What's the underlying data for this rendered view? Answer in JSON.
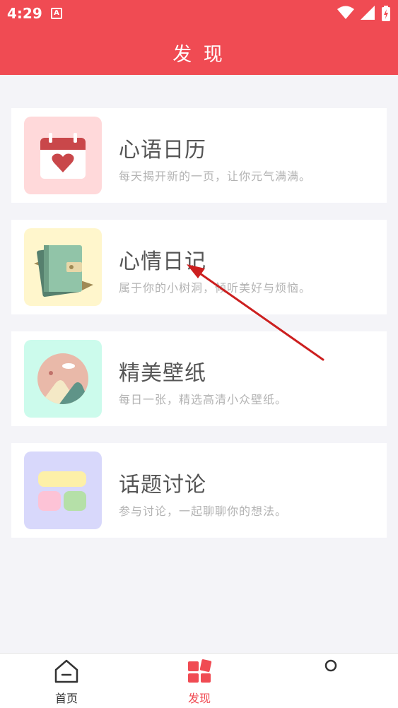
{
  "status_bar": {
    "time": "4:29",
    "app_icon": "A"
  },
  "header": {
    "title": "发 现"
  },
  "cards": [
    {
      "title": "心语日历",
      "desc": "每天揭开新的一页，让你元气满满。",
      "icon": "calendar-heart-icon",
      "bg": "#ffd9da"
    },
    {
      "title": "心情日记",
      "desc": "属于你的小树洞，倾听美好与烦恼。",
      "icon": "diary-notebook-icon",
      "bg": "#fff6cc"
    },
    {
      "title": "精美壁纸",
      "desc": "每日一张，精选高清小众壁纸。",
      "icon": "landscape-picture-icon",
      "bg": "#ccfbec"
    },
    {
      "title": "话题讨论",
      "desc": "参与讨论，一起聊聊你的想法。",
      "icon": "topic-blocks-icon",
      "bg": "#d8d8fb"
    }
  ],
  "tabbar": [
    {
      "label": "首页",
      "icon": "home-icon"
    },
    {
      "label": "发现",
      "icon": "discover-icon",
      "active": true
    },
    {
      "label": "",
      "icon": "profile-icon"
    }
  ],
  "colors": {
    "accent": "#f04b53",
    "annotation_arrow": "#cc1f1f"
  }
}
